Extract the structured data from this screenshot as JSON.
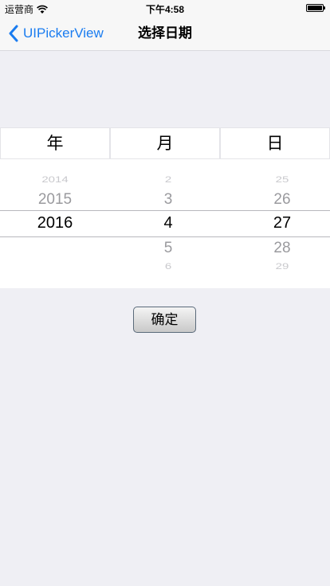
{
  "status_bar": {
    "carrier": "运营商",
    "time": "下午4:58"
  },
  "nav": {
    "back_label": "UIPickerView",
    "title": "选择日期"
  },
  "header": [
    "年",
    "月",
    "日"
  ],
  "picker": {
    "year": [
      "2014",
      "2015",
      "2016"
    ],
    "month": [
      "2",
      "3",
      "4",
      "5",
      "6"
    ],
    "day": [
      "25",
      "26",
      "27",
      "28",
      "29"
    ]
  },
  "confirm_label": "确定",
  "colors": {
    "accent": "#1a7cf0",
    "background": "#efeff4"
  }
}
